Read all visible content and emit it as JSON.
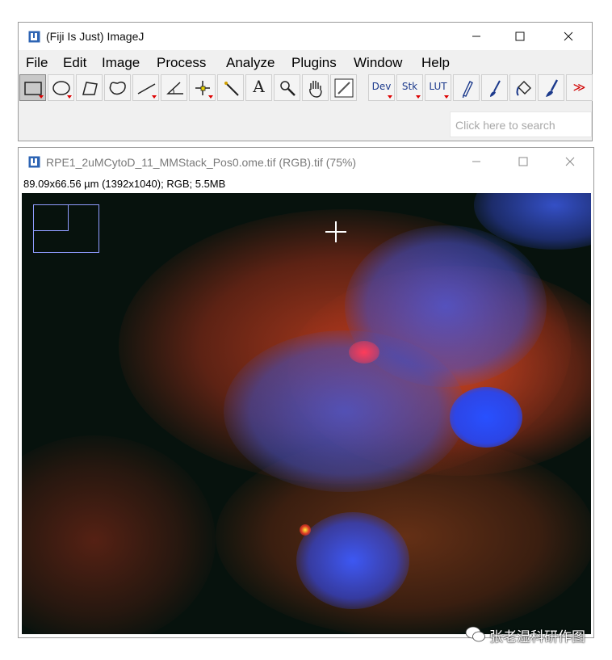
{
  "main_window": {
    "title": "(Fiji Is Just) ImageJ",
    "menus": [
      "File",
      "Edit",
      "Image",
      "Process",
      "Analyze",
      "Plugins",
      "Window",
      "Help"
    ],
    "tools": [
      {
        "name": "rectangle-tool",
        "icon": "rectangle-icon"
      },
      {
        "name": "oval-tool",
        "icon": "oval-icon"
      },
      {
        "name": "polygon-tool",
        "icon": "polygon-icon"
      },
      {
        "name": "freehand-tool",
        "icon": "freehand-icon"
      },
      {
        "name": "line-tool",
        "icon": "line-icon"
      },
      {
        "name": "angle-tool",
        "icon": "angle-icon"
      },
      {
        "name": "point-tool",
        "icon": "point-icon"
      },
      {
        "name": "wand-tool",
        "icon": "wand-icon"
      },
      {
        "name": "text-tool",
        "icon": "text-icon",
        "label": "A"
      },
      {
        "name": "zoom-tool",
        "icon": "magnifier-icon"
      },
      {
        "name": "scroll-tool",
        "icon": "hand-icon"
      },
      {
        "name": "color-picker-tool",
        "icon": "eyedropper-icon"
      },
      {
        "name": "dev-tool",
        "icon": "dev-icon",
        "label": "Dev"
      },
      {
        "name": "stack-tool",
        "icon": "stack-icon",
        "label": "Stk"
      },
      {
        "name": "lut-tool",
        "icon": "lut-icon",
        "label": "LUT"
      },
      {
        "name": "pencil-tool",
        "icon": "pencil-icon"
      },
      {
        "name": "brush-tool",
        "icon": "brush-icon"
      },
      {
        "name": "flood-fill-tool",
        "icon": "bucket-icon"
      },
      {
        "name": "paintbrush-tool",
        "icon": "paintbrush-icon"
      },
      {
        "name": "more-tools",
        "icon": "more-icon",
        "label": "≫"
      }
    ],
    "search_placeholder": "Click here to search"
  },
  "image_window": {
    "title": "RPE1_2uMCytoD_11_MMStack_Pos0.ome.tif (RGB).tif (75%)",
    "info": "89.09x66.56 µm (1392x1040); RGB; 5.5MB"
  },
  "watermark": {
    "text": "张老湿科研作图"
  },
  "colors": {
    "accent_blue": "#1c3a8c",
    "channel_red": "#c8321e",
    "channel_blue": "#2850e6",
    "channel_green": "#3cff3c"
  }
}
